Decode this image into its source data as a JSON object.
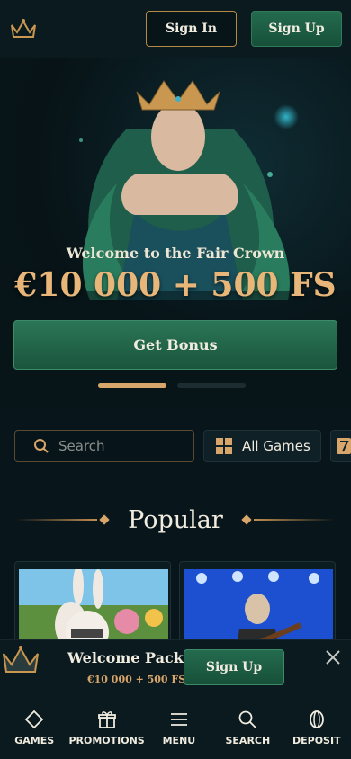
{
  "header": {
    "logo_icon": "crown-icon",
    "sign_in_label": "Sign In",
    "sign_up_label": "Sign Up"
  },
  "hero": {
    "subtitle": "Welcome to the Fair Crown",
    "title": "€10 000 + 500 FS",
    "bonus_label": "Get Bonus",
    "carousel": {
      "active_index": 0,
      "count": 2
    }
  },
  "search": {
    "placeholder": "Search",
    "icon": "search-icon",
    "all_games_label": "All Games",
    "all_games_icon": "grid-icon"
  },
  "popular": {
    "title": "Popular"
  },
  "welcome_pack": {
    "title": "Welcome Pack",
    "amount": "€10 000 + 500 FS",
    "sign_up_label": "Sign Up",
    "close_icon": "close-icon"
  },
  "nav": {
    "items": [
      {
        "label": "GAMES",
        "icon": "diamond-icon"
      },
      {
        "label": "PROMOTIONS",
        "icon": "gift-icon"
      },
      {
        "label": "MENU",
        "icon": "hamburger-icon"
      },
      {
        "label": "SEARCH",
        "icon": "search-icon"
      },
      {
        "label": "DEPOSIT",
        "icon": "coin-icon"
      }
    ]
  },
  "colors": {
    "background": "#08151a",
    "accent_gold": "#d8a56a",
    "accent_green": "#246b4e"
  }
}
